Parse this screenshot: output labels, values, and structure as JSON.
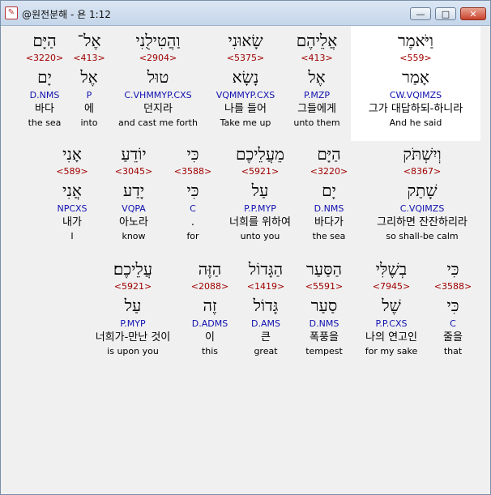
{
  "window": {
    "title": "@원전분해 - 욘 1:12",
    "icon": "app-logo-icon",
    "controls": {
      "minimize": "—",
      "maximize": "□",
      "close": "✕"
    }
  },
  "rows": [
    {
      "words": [
        {
          "heb": "וַיֹּאמֶר",
          "strong": "<559>",
          "lemma": "אָמַר",
          "parse": "CW.VQIMZS",
          "kor": "그가 대답하되-하니라",
          "eng": "And he said",
          "highlight": true
        },
        {
          "heb": "אֲלֵיהֶם",
          "strong": "<413>",
          "lemma": "אֶל",
          "parse": "P.MZP",
          "kor": "그들에게",
          "eng": "unto them"
        },
        {
          "heb": "שָׂאוּנִי",
          "strong": "<5375>",
          "lemma": "נָשָׂא",
          "parse": "VQMMYP.CXS",
          "kor": "나를 들어",
          "eng": "Take me up"
        },
        {
          "heb": "וַהֲטִילֻנִי",
          "strong": "<2904>",
          "lemma": "טוּל",
          "parse": "C.VHMMYP.CXS",
          "kor": "던지라",
          "eng": "and cast me forth"
        },
        {
          "heb": "אֶל־",
          "strong": "<413>",
          "lemma": "אֶל",
          "parse": "P",
          "kor": "에",
          "eng": "into"
        },
        {
          "heb": "הַיָּם",
          "strong": "<3220>",
          "lemma": "יָם",
          "parse": "D.NMS",
          "kor": "바다",
          "eng": "the sea"
        }
      ]
    },
    {
      "words": [
        {
          "heb": "וְיִשְׁתֹּק",
          "strong": "<8367>",
          "lemma": "שָׁתַק",
          "parse": "C.VQIMZS",
          "kor": "그리하면 잔잔하리라",
          "eng": "so shall-be calm"
        },
        {
          "heb": "הַיָּם",
          "strong": "<3220>",
          "lemma": "יָם",
          "parse": "D.NMS",
          "kor": "바다가",
          "eng": "the sea"
        },
        {
          "heb": "מֵעֲלֵיכֶם",
          "strong": "<5921>",
          "lemma": "עַל",
          "parse": "P.P.MYP",
          "kor": "너희를 위하여",
          "eng": "unto you"
        },
        {
          "heb": "כִּי",
          "strong": "<3588>",
          "lemma": "כִּי",
          "parse": "C",
          "kor": ".",
          "eng": "for"
        },
        {
          "heb": "יוֹדֵעַ",
          "strong": "<3045>",
          "lemma": "יָדַע",
          "parse": "VQPA",
          "kor": "아노라",
          "eng": "know"
        },
        {
          "heb": "אָנִי",
          "strong": "<589>",
          "lemma": "אֲנִי",
          "parse": "NPCXS",
          "kor": "내가",
          "eng": "I"
        }
      ]
    },
    {
      "words": [
        {
          "heb": "כִּי",
          "strong": "<3588>",
          "lemma": "כִּי",
          "parse": "C",
          "kor": "줄을",
          "eng": "that"
        },
        {
          "heb": "בְשֶׁלִּי",
          "strong": "<7945>",
          "lemma": "שֶׁל",
          "parse": "P.P.CXS",
          "kor": "나의 연고인",
          "eng": "for my sake"
        },
        {
          "heb": "הַסַּעַר",
          "strong": "<5591>",
          "lemma": "סַעַר",
          "parse": "D.NMS",
          "kor": "폭풍을",
          "eng": "tempest"
        },
        {
          "heb": "הַגָּדוֹל",
          "strong": "<1419>",
          "lemma": "גָּדוֹל",
          "parse": "D.AMS",
          "kor": "큰",
          "eng": "great"
        },
        {
          "heb": "הַזֶּה",
          "strong": "<2088>",
          "lemma": "זֶה",
          "parse": "D.ADMS",
          "kor": "이",
          "eng": "this"
        },
        {
          "heb": "עֲלֵיכֶם׃",
          "strong": "<5921>",
          "lemma": "עַל",
          "parse": "P.MYP",
          "kor": "너희가-만난 것이",
          "eng": "is upon you"
        }
      ]
    }
  ]
}
